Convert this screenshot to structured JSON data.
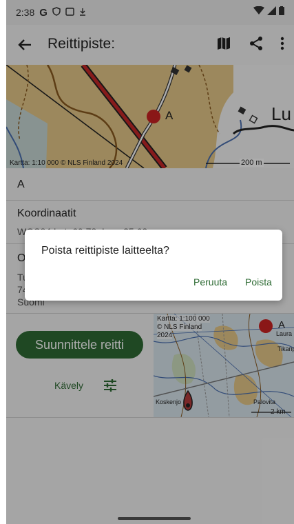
{
  "status": {
    "time": "2:38"
  },
  "appbar": {
    "title": "Reittipiste:"
  },
  "map_top": {
    "marker_label": "A",
    "place_label": "Lu",
    "attribution": "Kartta: 1:10 000 © NLS Finland 2024",
    "scale": "200 m"
  },
  "name_row": {
    "value": "A"
  },
  "coords_row": {
    "label": "Koordinaatit",
    "value": "WGS84 Lat: 60.78, Lon: 25.63"
  },
  "address_row": {
    "label_initial": "O",
    "line1": "Tu",
    "line2": "74",
    "line3": "Suomi"
  },
  "route": {
    "plan_label": "Suunnittele reitti",
    "mode_label": "Kävely"
  },
  "map_mini": {
    "attribution_line1": "Kartta: 1:100 000",
    "attribution_line2": "© NLS Finland",
    "attribution_line3": "2024",
    "marker_label": "A",
    "place_left": "Koskenjo",
    "place_right": "Palovita",
    "scale": "2 km",
    "place_top_right": "Laura",
    "place_right2": "Tikanp"
  },
  "dialog": {
    "message": "Poista reittipiste laitteelta?",
    "cancel_label": "Peruuta",
    "delete_label": "Poista"
  },
  "colors": {
    "accent": "#2e6b34",
    "marker": "#cc2222",
    "map_tan": "#e6c98a"
  }
}
